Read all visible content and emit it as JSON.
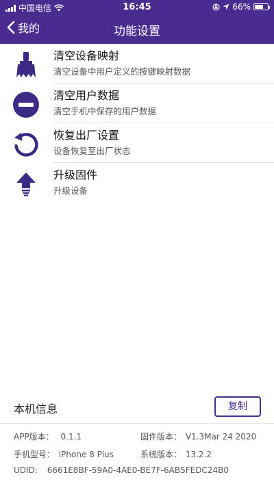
{
  "status_bar": {
    "carrier": "中国电信",
    "time": "16:45",
    "battery": "66%",
    "battery_level": 0.66
  },
  "nav": {
    "back_label": "我的",
    "title": "功能设置"
  },
  "items": [
    {
      "title": "清空设备映射",
      "subtitle": "清空设备中用户定义的按键映射数据",
      "icon": "broom-icon"
    },
    {
      "title": "清空用户数据",
      "subtitle": "清空手机中保存的用户数据",
      "icon": "minus-circle-icon"
    },
    {
      "title": "恢复出厂设置",
      "subtitle": "设备恢复至出厂状态",
      "icon": "restore-icon"
    },
    {
      "title": "升级固件",
      "subtitle": "升级设备",
      "icon": "upgrade-arrow-icon"
    }
  ],
  "device_info": {
    "title": "本机信息",
    "copy_label": "复制",
    "app_version_label": "APP版本：",
    "app_version": "0.1.1",
    "firmware_version_label": "固件版本：",
    "firmware_version": "V1.3Mar 24 2020",
    "phone_model_label": "手机型号：",
    "phone_model": "iPhone 8 Plus",
    "system_version_label": "系统版本：",
    "system_version": "13.2.2",
    "udid_label": "UDID:",
    "udid": "6661E8BF-59A0-4AE0-BE7F-6AB5FEDC24B0"
  },
  "colors": {
    "accent": "#4a2c91",
    "icon": "#3d2a86"
  }
}
